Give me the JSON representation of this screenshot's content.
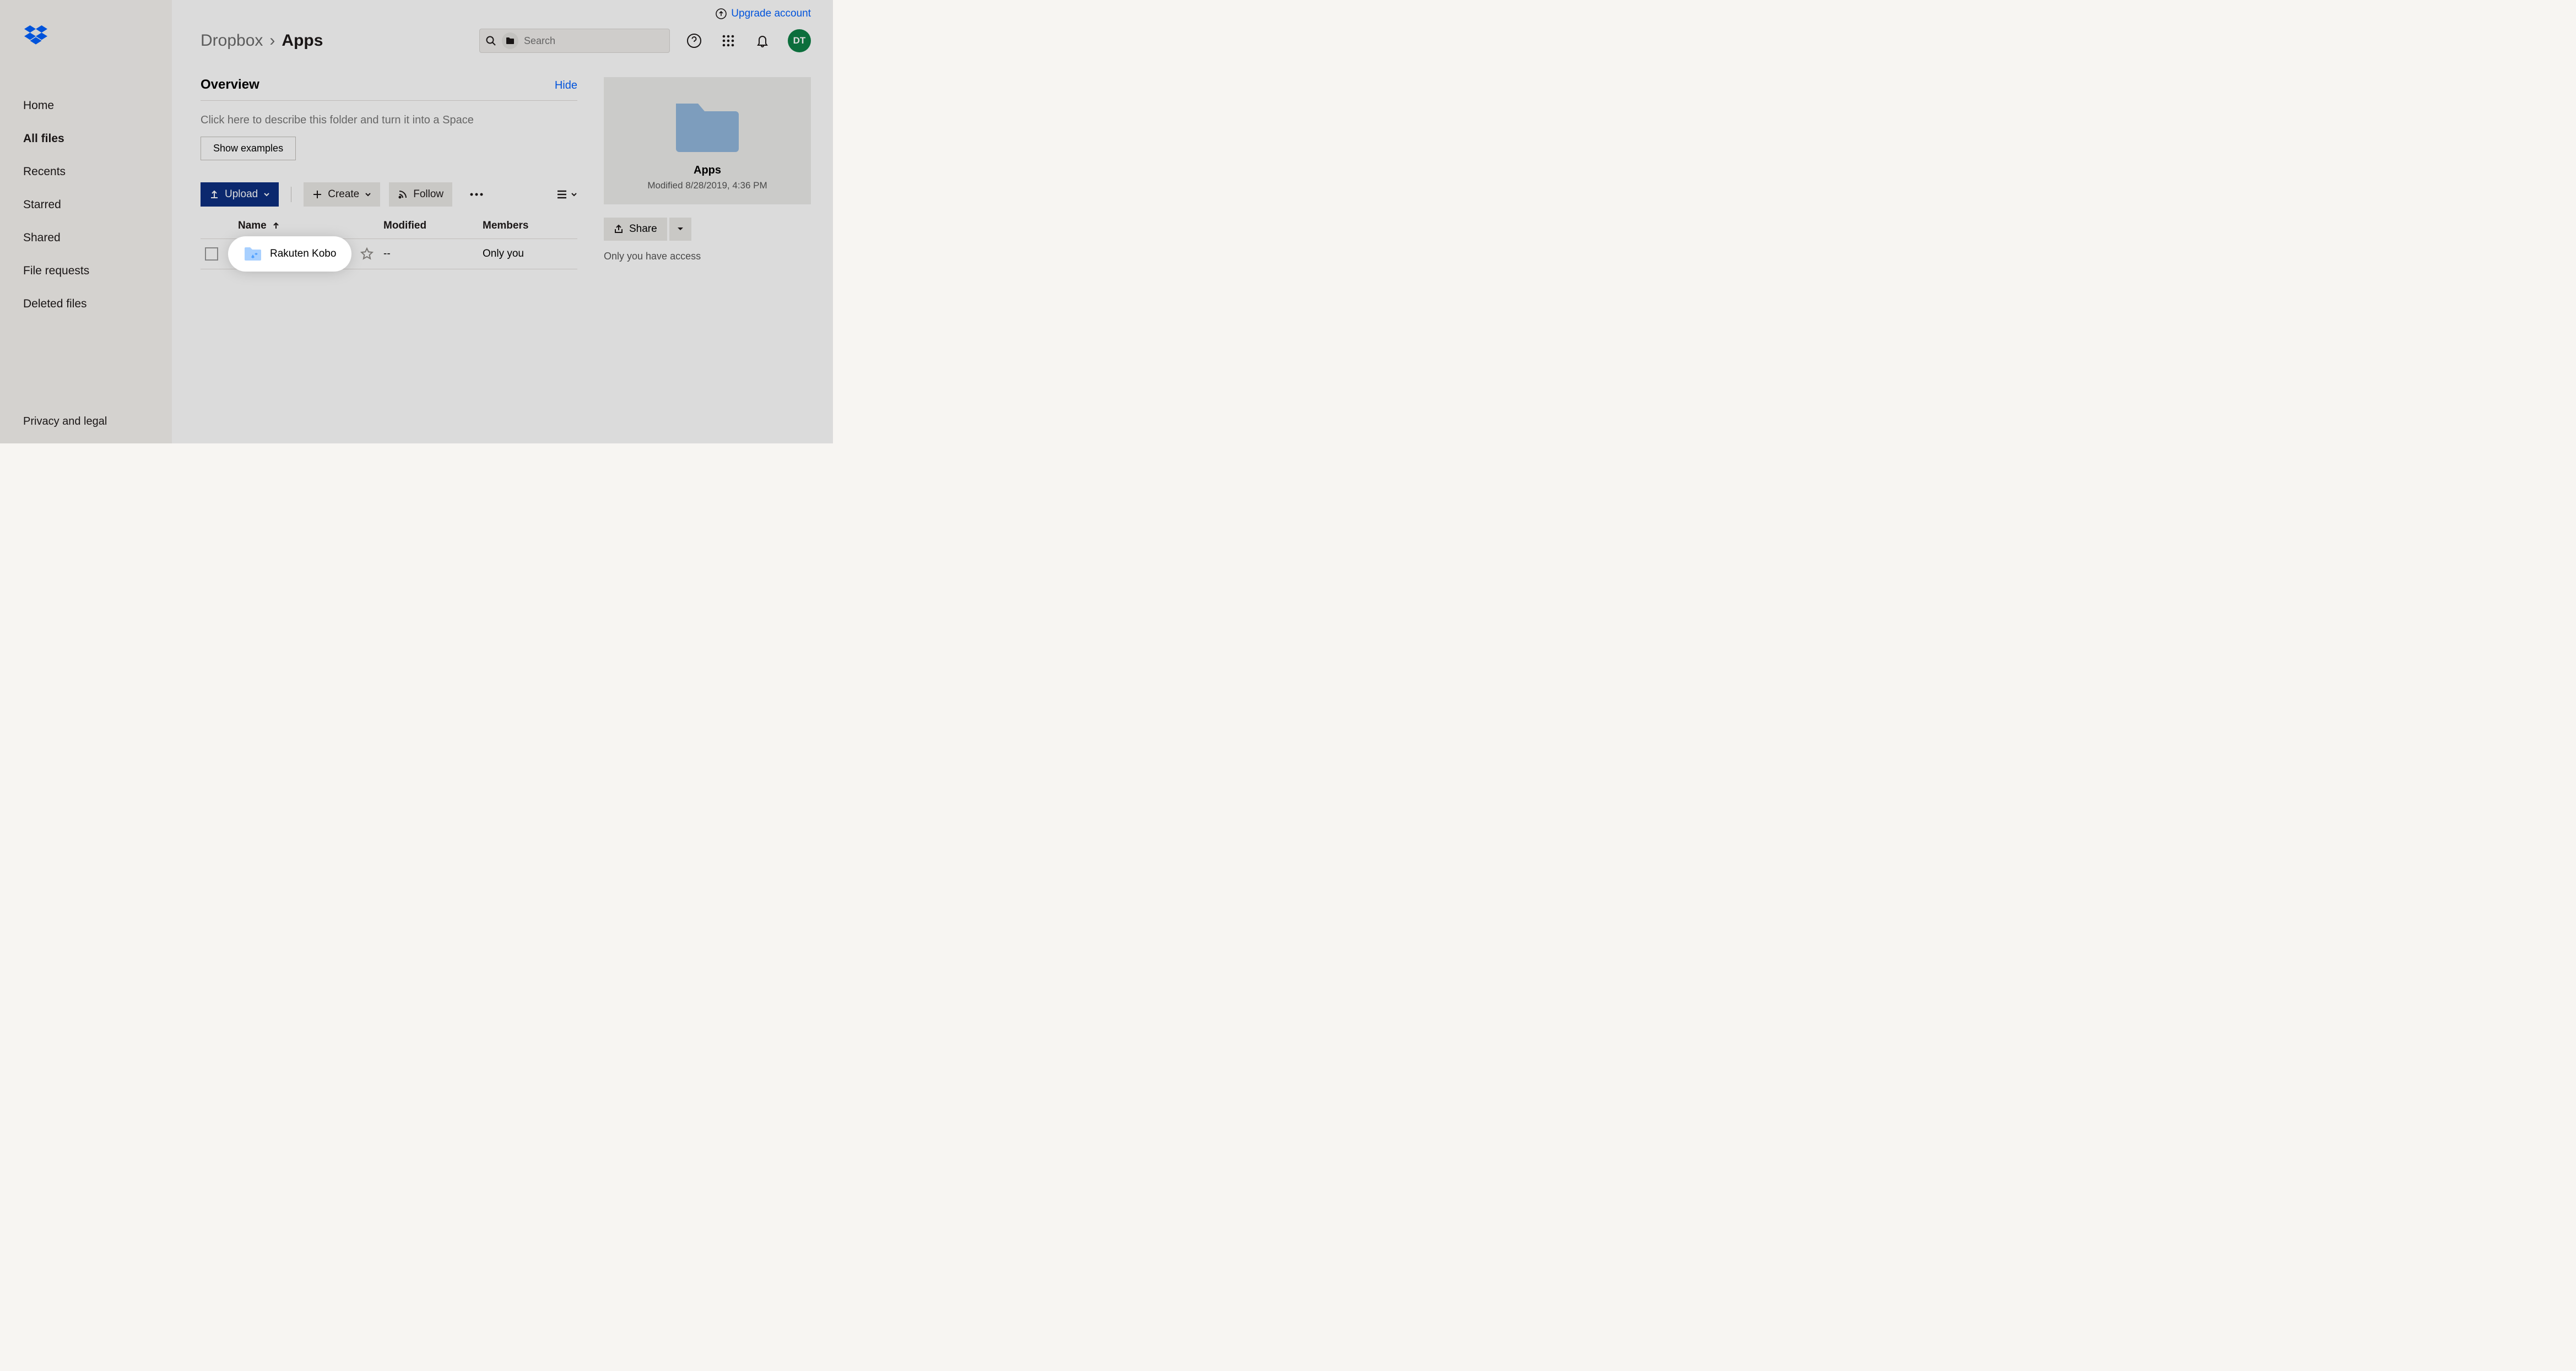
{
  "topbar": {
    "upgrade_label": "Upgrade account"
  },
  "avatar": "DT",
  "sidebar": {
    "items": [
      "Home",
      "All files",
      "Recents",
      "Starred",
      "Shared",
      "File requests",
      "Deleted files"
    ],
    "active_index": 1,
    "footer": "Privacy and legal"
  },
  "breadcrumb": {
    "root": "Dropbox",
    "current": "Apps"
  },
  "search": {
    "placeholder": "Search"
  },
  "overview": {
    "title": "Overview",
    "hide": "Hide",
    "placeholder": "Click here to describe this folder and turn it into a Space",
    "show_examples": "Show examples"
  },
  "toolbar": {
    "upload": "Upload",
    "create": "Create",
    "follow": "Follow"
  },
  "table": {
    "columns": {
      "name": "Name",
      "modified": "Modified",
      "members": "Members"
    },
    "rows": [
      {
        "name": "Rakuten Kobo",
        "modified": "--",
        "members": "Only you"
      }
    ]
  },
  "details": {
    "name": "Apps",
    "modified_label": "Modified 8/28/2019, 4:36 PM",
    "share_label": "Share",
    "access_text": "Only you have access"
  }
}
